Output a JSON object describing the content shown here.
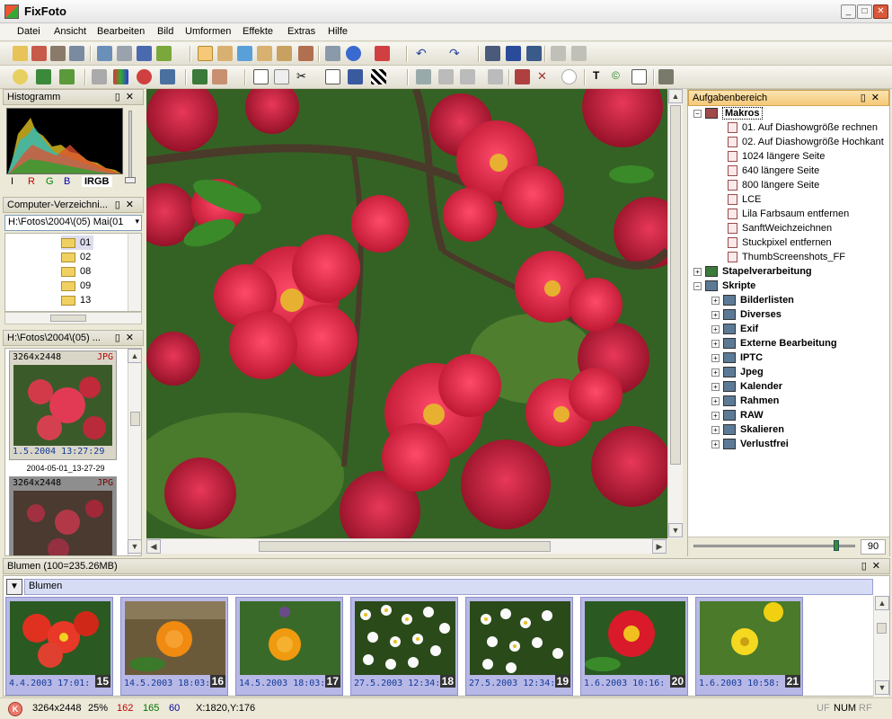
{
  "window": {
    "title": "FixFoto"
  },
  "menu": [
    "Datei",
    "Ansicht",
    "Bearbeiten",
    "Bild",
    "Umformen",
    "Effekte",
    "Extras",
    "Hilfe"
  ],
  "panels": {
    "histogram": {
      "title": "Histogramm",
      "tabs": [
        "I",
        "R",
        "G",
        "B",
        "IRGB"
      ]
    },
    "explorer": {
      "title": "Computer-Verzeichni...",
      "path": "H:\\Fotos\\2004\\(05) Mai(01",
      "folders": [
        "01",
        "02",
        "08",
        "09",
        "13"
      ]
    },
    "browser": {
      "title": "H:\\Fotos\\2004\\(05) ...",
      "thumb1": {
        "size": "3264x2448",
        "type": "JPG",
        "date": "1.5.2004 13:27:29",
        "name": "2004-05-01_13-27-29"
      },
      "thumb2": {
        "size": "3264x2448",
        "type": "JPG"
      }
    },
    "tasks": {
      "title": "Aufgabenbereich",
      "makros_label": "Makros",
      "makros": [
        "01. Auf Diashowgröße rechnen",
        "02. Auf Diashowgröße Hochkant",
        "1024 längere Seite",
        "640 längere Seite",
        "800 längere Seite",
        "LCE",
        "Lila Farbsaum entfernen",
        "SanftWeichzeichnen",
        "Stuckpixel entfernen",
        "ThumbScreenshots_FF"
      ],
      "stapel_label": "Stapelverarbeitung",
      "skripte_label": "Skripte",
      "skripte": [
        "Bilderlisten",
        "Diverses",
        "Exif",
        "Externe Bearbeitung",
        "IPTC",
        "Jpeg",
        "Kalender",
        "Rahmen",
        "RAW",
        "Skalieren",
        "Verlustfrei"
      ],
      "zoom_value": "90"
    }
  },
  "filmstrip": {
    "title": "Blumen (100=235.26MB)",
    "album": "Blumen",
    "items": [
      {
        "date": "4.4.2003 17:01:",
        "num": "15"
      },
      {
        "date": "14.5.2003 18:03:",
        "num": "16"
      },
      {
        "date": "14.5.2003 18:03:",
        "num": "17"
      },
      {
        "date": "27.5.2003 12:34:",
        "num": "18"
      },
      {
        "date": "27.5.2003 12:34:",
        "num": "19"
      },
      {
        "date": "1.6.2003 10:16:",
        "num": "20"
      },
      {
        "date": "1.6.2003 10:58:",
        "num": "21"
      }
    ]
  },
  "status": {
    "dims": "3264x2448",
    "zoom": "25%",
    "r": "162",
    "g": "165",
    "b": "60",
    "coords": "X:1820,Y:176",
    "uf": "UF",
    "num": "NUM",
    "rf": "RF"
  },
  "colors": {
    "r": "#c00000",
    "g": "#007000",
    "b": "#0000a0",
    "accent": "#f5c978"
  }
}
